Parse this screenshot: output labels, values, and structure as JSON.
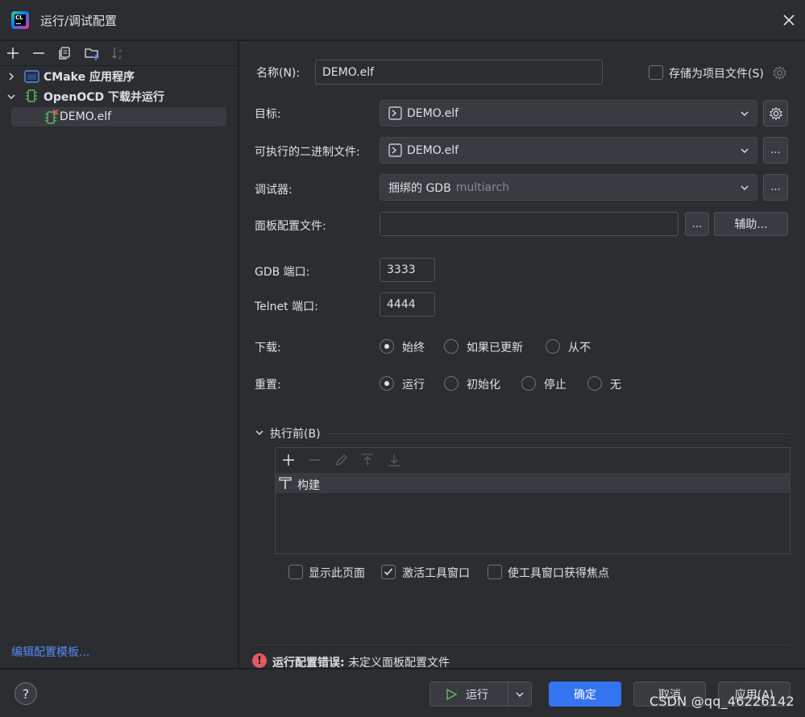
{
  "window": {
    "title": "运行/调试配置"
  },
  "colors": {
    "accent": "#3574f0",
    "error": "#e55765",
    "link": "#548af7"
  },
  "tree": {
    "items": [
      {
        "label": "CMake 应用程序",
        "icon": "cmake-app-icon",
        "expanded": false
      },
      {
        "label": "OpenOCD 下载并运行",
        "icon": "chip-icon",
        "expanded": true
      },
      {
        "label": "DEMO.elf",
        "icon": "chip-error-icon",
        "selected": true
      }
    ],
    "edit_templates": "编辑配置模板..."
  },
  "form": {
    "name_label": "名称(N):",
    "name_value": "DEMO.elf",
    "store_label": "存储为项目文件(S)",
    "target_label": "目标:",
    "target_value": "DEMO.elf",
    "exe_label": "可执行的二进制文件:",
    "exe_value": "DEMO.elf",
    "debugger_label": "调试器:",
    "debugger_value": "捆绑的 GDB",
    "debugger_hint": "multiarch",
    "board_label": "面板配置文件:",
    "board_value": "",
    "browse": "...",
    "assist": "辅助...",
    "gdb_port_label": "GDB 端口:",
    "gdb_port": "3333",
    "telnet_port_label": "Telnet 端口:",
    "telnet_port": "4444",
    "download_label": "下载:",
    "download_options": [
      "始终",
      "如果已更新",
      "从不"
    ],
    "download_selected": 0,
    "reset_label": "重置:",
    "reset_options": [
      "运行",
      "初始化",
      "停止",
      "无"
    ],
    "reset_selected": 0
  },
  "before_launch": {
    "title": "执行前(B)",
    "tasks": [
      "构建"
    ],
    "options": [
      {
        "label": "显示此页面",
        "checked": false
      },
      {
        "label": "激活工具窗口",
        "checked": true
      },
      {
        "label": "使工具窗口获得焦点",
        "checked": false
      }
    ]
  },
  "error": {
    "prefix": "运行配置错误:",
    "message": "未定义面板配置文件"
  },
  "footer": {
    "help": "?",
    "run": "运行",
    "ok": "确定",
    "cancel": "取消",
    "apply": "应用(A)",
    "watermark": "CSDN @qq_46226142"
  }
}
